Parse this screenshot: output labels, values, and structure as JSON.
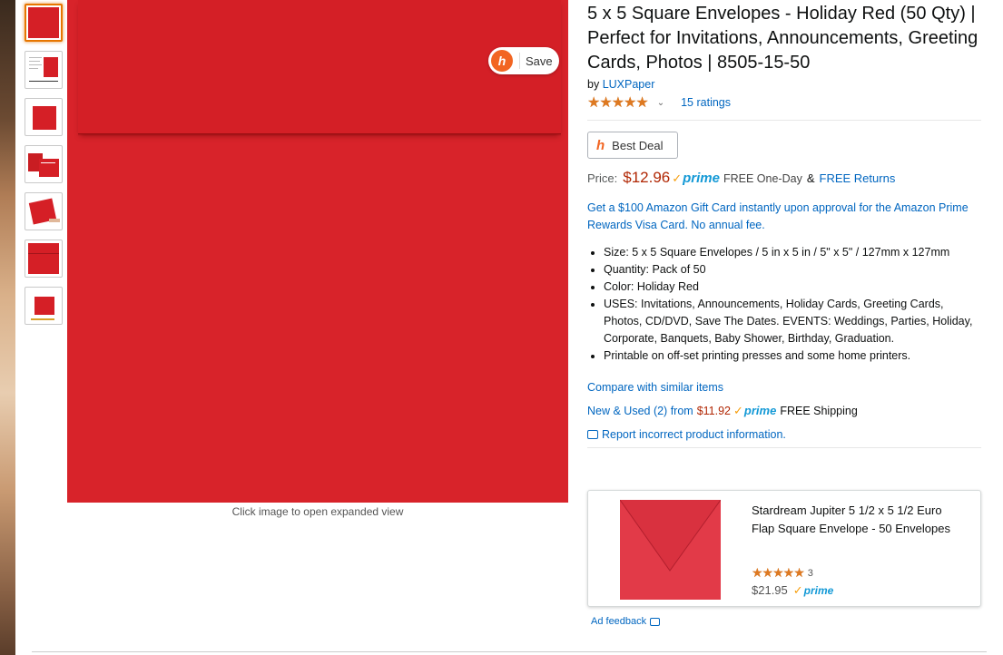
{
  "gallery": {
    "thumbnail_count": 7,
    "caption": "Click image to open expanded view"
  },
  "save_overlay": {
    "label": "Save",
    "icon": "honey-icon"
  },
  "product": {
    "title": "5 x 5 Square Envelopes - Holiday Red (50 Qty) | Perfect for Invitations, Announcements, Greeting Cards, Photos | 8505-15-50",
    "by_label": "by",
    "brand": "LUXPaper",
    "stars": "★★★★★",
    "rating_count": "15 ratings",
    "best_deal_label": "Best Deal",
    "price_label": "Price:",
    "price": "$12.96",
    "prime_label": "prime",
    "free_delivery": "FREE One-Day",
    "amp": "&",
    "free_returns": "FREE Returns",
    "promo": "Get a $100 Amazon Gift Card instantly upon approval for the Amazon Prime Rewards Visa Card. No annual fee.",
    "bullets": [
      "Size: 5 x 5 Square Envelopes / 5 in x 5 in / 5\" x 5\" / 127mm x 127mm",
      "Quantity: Pack of 50",
      "Color: Holiday Red",
      "USES: Invitations, Announcements, Holiday Cards, Greeting Cards, Photos, CD/DVD, Save The Dates. EVENTS: Weddings, Parties, Holiday, Corporate, Banquets, Baby Shower, Birthday, Graduation.",
      "Printable on off-set printing presses and some home printers."
    ],
    "compare_link": "Compare with similar items",
    "new_used_label": "New & Used (2) from",
    "new_used_price": "$11.92",
    "free_shipping": "FREE Shipping",
    "report_link": "Report incorrect product information."
  },
  "ad": {
    "title": "Stardream Jupiter 5 1/2 x 5 1/2 Euro Flap Square Envelope - 50 Envelopes",
    "stars": "★★★★★",
    "rating_count": "3",
    "price": "$21.95",
    "prime_label": "prime",
    "feedback_label": "Ad feedback"
  },
  "colors": {
    "envelope_red": "#d8232a",
    "ad_envelope": "#e23a48",
    "price_red": "#b12704",
    "link_blue": "#0066c0",
    "prime_blue": "#1399d6",
    "star_orange": "#de7921",
    "honey_orange": "#f26522"
  }
}
